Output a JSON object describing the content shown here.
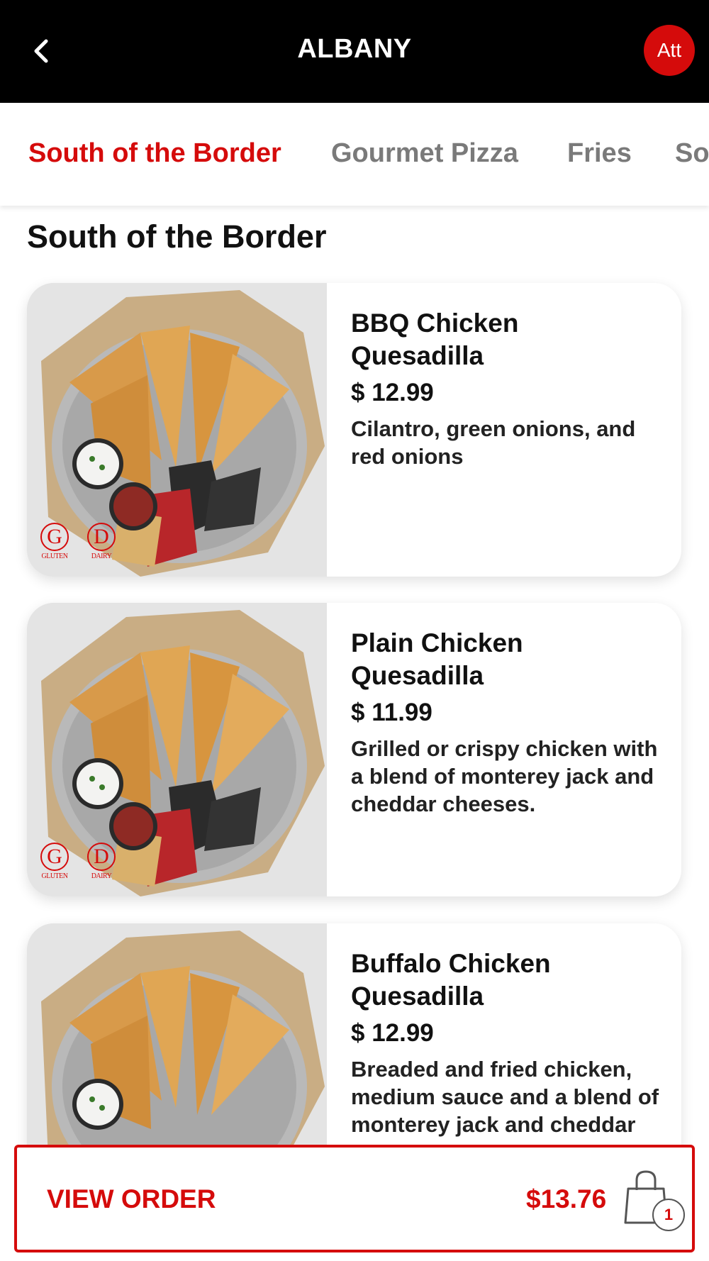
{
  "header": {
    "title": "ALBANY",
    "avatar_label": "Att"
  },
  "tabs": [
    {
      "label": "South of the Border",
      "active": true
    },
    {
      "label": "Gourmet Pizza",
      "active": false
    },
    {
      "label": "Fries",
      "active": false
    },
    {
      "label": "So",
      "active": false
    }
  ],
  "section_title": "South of the Border",
  "items": [
    {
      "name_line1": "BBQ Chicken",
      "name_line2": "Quesadilla",
      "price": "$ 12.99",
      "description": "Cilantro, green onions, and red onions",
      "dietary": [
        {
          "symbol": "G",
          "label": "GLUTEN"
        },
        {
          "symbol": "D",
          "label": "DAIRY"
        }
      ]
    },
    {
      "name_line1": "Plain Chicken",
      "name_line2": "Quesadilla",
      "price": "$ 11.99",
      "description": "Grilled or crispy chicken with a blend of monterey jack and cheddar cheeses.",
      "dietary": [
        {
          "symbol": "G",
          "label": "GLUTEN"
        },
        {
          "symbol": "D",
          "label": "DAIRY"
        }
      ]
    },
    {
      "name_line1": "Buffalo Chicken",
      "name_line2": "Quesadilla",
      "price": "$ 12.99",
      "description": "Breaded and fried chicken, medium sauce and a blend of monterey jack and cheddar",
      "dietary": []
    }
  ],
  "order_bar": {
    "label": "VIEW ORDER",
    "total": "$13.76",
    "bag_count": "1"
  },
  "colors": {
    "accent": "#d50b0b",
    "header_bg": "#000000",
    "inactive_tab": "#7a7a7a"
  },
  "icons": [
    "back-chevron-icon",
    "shopping-bag-icon"
  ]
}
